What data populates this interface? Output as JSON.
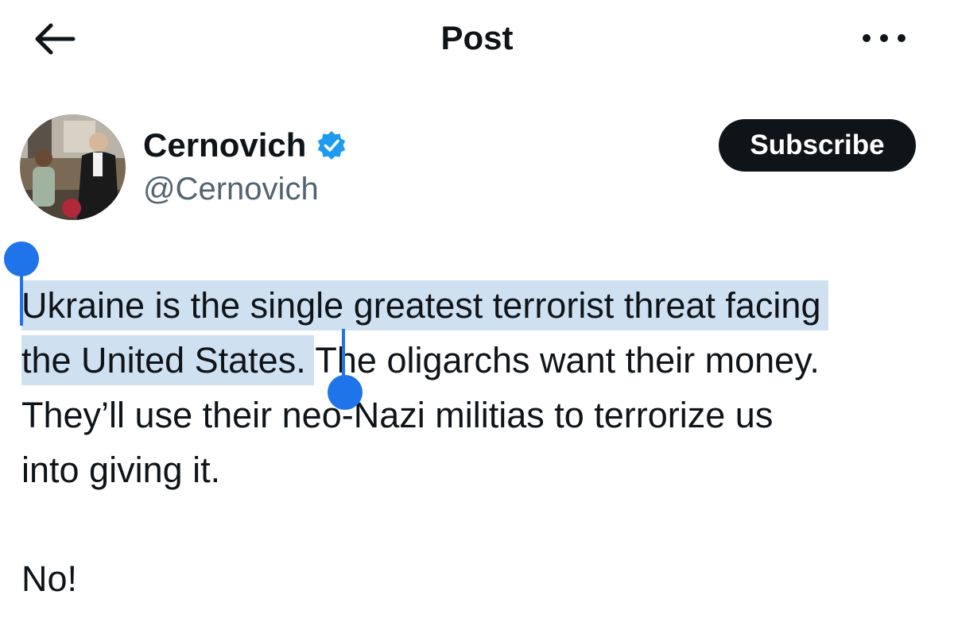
{
  "header": {
    "back_icon": "arrow-left-icon",
    "title": "Post",
    "more_icon": "more-horizontal-icon"
  },
  "author": {
    "name": "Cernovich",
    "handle": "@Cernovich",
    "verified_icon": "verified-badge-icon",
    "verified_color": "#1d9bf0"
  },
  "actions": {
    "subscribe_label": "Subscribe"
  },
  "post": {
    "line1_selected": "Ukraine is the single greatest terrorist threat facing",
    "line2_selected": "the United States.",
    "line2_rest": " The oligarchs want their money.",
    "line3": "They’ll use their neo-Nazi militias to terrorize us",
    "line4": "into giving it.",
    "closing": "No!"
  },
  "selection": {
    "highlight_color": "#cfe0f1",
    "handle_color": "#1e74e8"
  }
}
